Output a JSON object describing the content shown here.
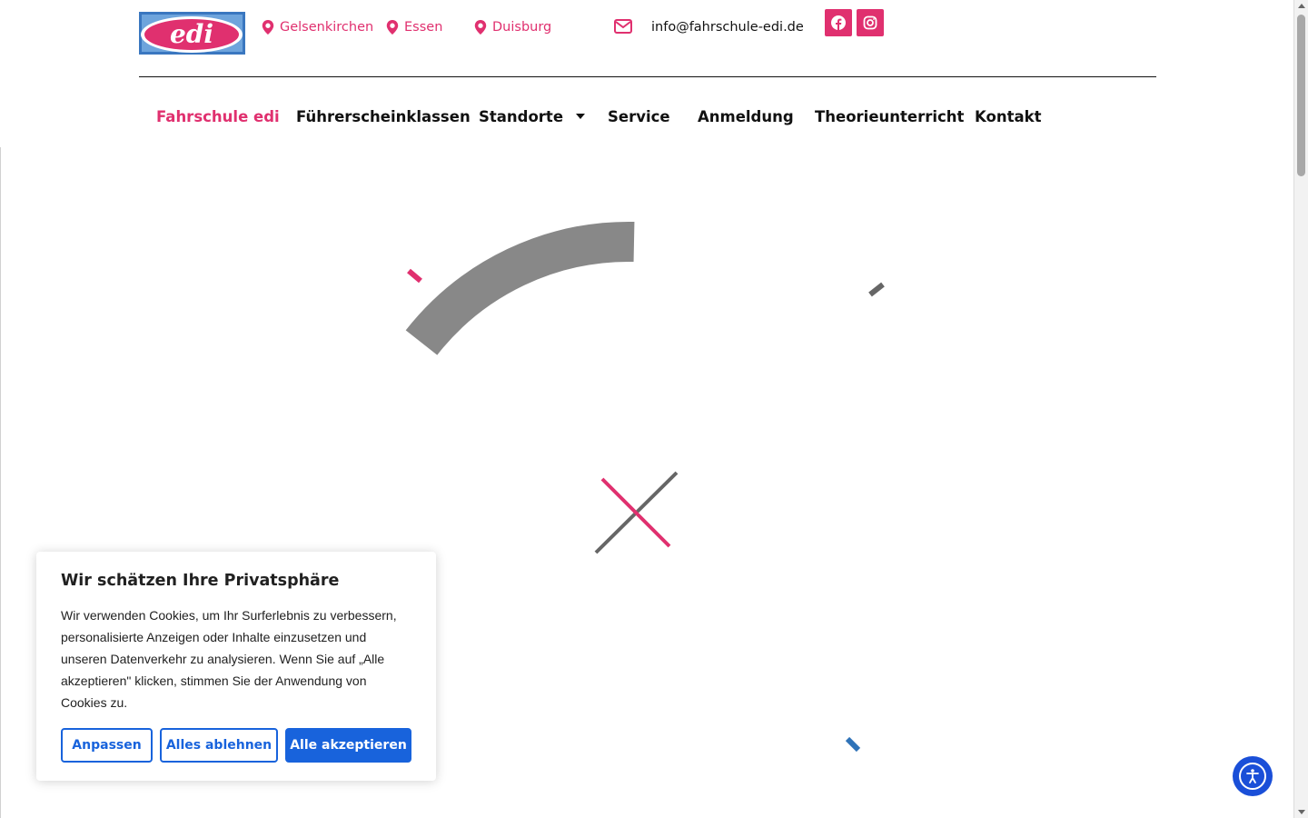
{
  "brand": {
    "logo_text": "edi",
    "colors": {
      "pink": "#e0306f",
      "blue": "#1863dc",
      "logo_blue": "#3a77c0"
    }
  },
  "header": {
    "locations": [
      "Gelsenkirchen",
      "Essen",
      "Duisburg"
    ],
    "email": "info@fahrschule-edi.de",
    "social": [
      {
        "icon": "facebook-icon"
      },
      {
        "icon": "instagram-icon"
      }
    ]
  },
  "nav": {
    "items": [
      {
        "label": "Fahrschule edi",
        "active": true
      },
      {
        "label": "Führerscheinklassen"
      },
      {
        "label": "Standorte",
        "has_dropdown": true
      },
      {
        "label": "Service"
      },
      {
        "label": "Anmeldung"
      },
      {
        "label": "Theorieunterricht"
      },
      {
        "label": "Kontakt"
      }
    ]
  },
  "cookie_banner": {
    "title": "Wir schätzen Ihre Privatsphäre",
    "text": "Wir verwenden Cookies, um Ihr Surferlebnis zu verbessern, personalisierte Anzeigen oder Inhalte einzusetzen und unseren Datenverkehr zu analysieren. Wenn Sie auf „Alle akzeptieren\" klicken, stimmen Sie der Anwendung von Cookies zu.",
    "buttons": {
      "customize": "Anpassen",
      "reject": "Alles ablehnen",
      "accept": "Alle akzeptieren"
    }
  },
  "accessibility": {
    "icon": "accessibility-icon"
  }
}
